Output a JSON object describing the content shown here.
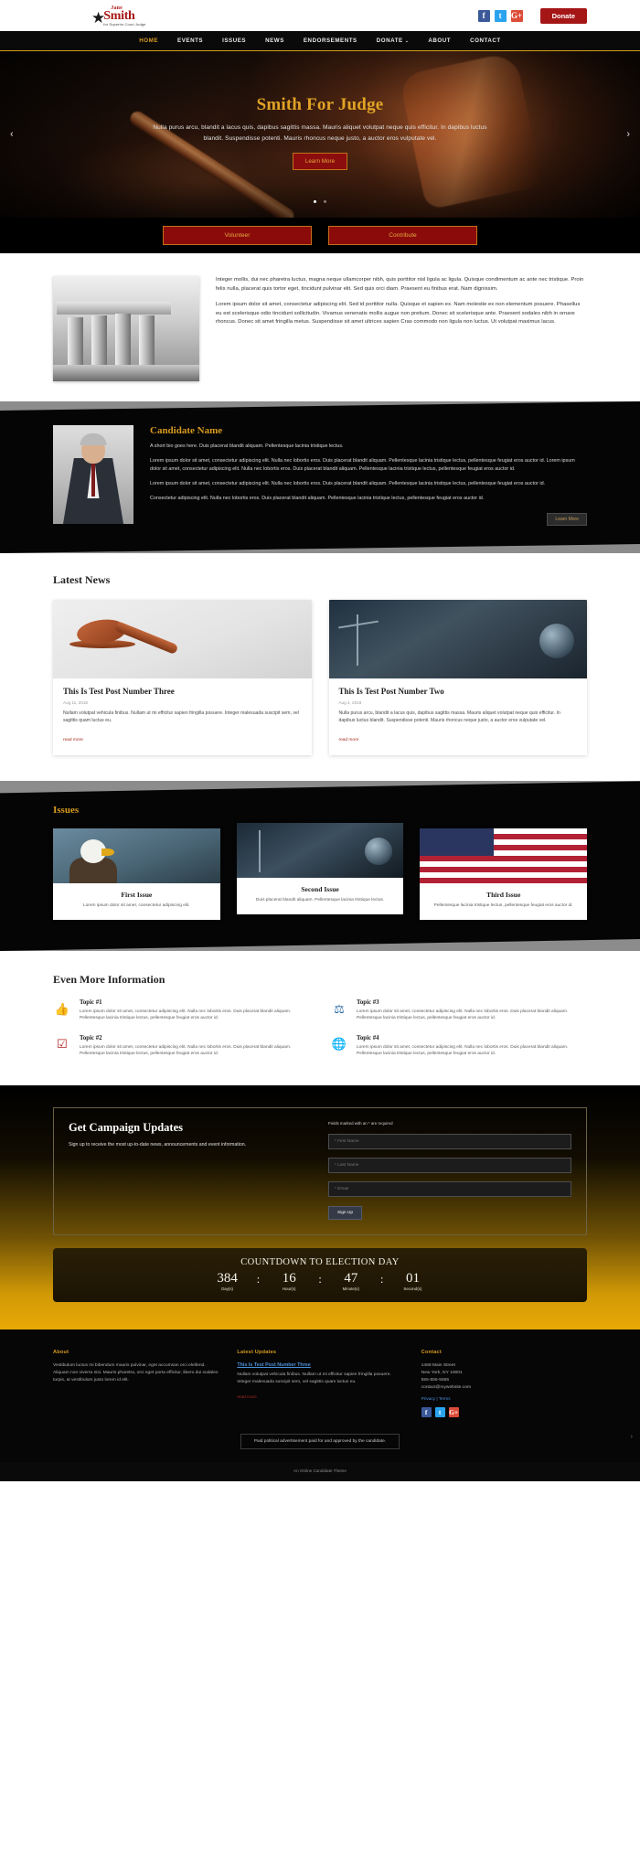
{
  "header": {
    "logo": {
      "first": "Jane",
      "last": "Smith",
      "tagline": "for Superior Court Judge",
      "star": "★"
    },
    "social": [
      {
        "name": "facebook-icon",
        "glyph": "f"
      },
      {
        "name": "twitter-icon",
        "glyph": "t"
      },
      {
        "name": "google-plus-icon",
        "glyph": "G+"
      }
    ],
    "donate_label": "Donate"
  },
  "nav": {
    "items": [
      {
        "label": "HOME",
        "active": true
      },
      {
        "label": "EVENTS",
        "active": false
      },
      {
        "label": "ISSUES",
        "active": false
      },
      {
        "label": "NEWS",
        "active": false
      },
      {
        "label": "ENDORSEMENTS",
        "active": false
      },
      {
        "label": "DONATE",
        "active": false,
        "caret": "⌄"
      },
      {
        "label": "ABOUT",
        "active": false
      },
      {
        "label": "CONTACT",
        "active": false
      }
    ]
  },
  "hero": {
    "title": "Smith For Judge",
    "subtitle": "Nulla purus arcu, blandit a lacus quis, dapibus sagittis massa. Mauris aliquet volutpat neque quis efficitur. In dapibus luctus blandit. Suspendisse potenti. Mauris rhoncus neque justo, a auctor eros vulputate vel.",
    "button": "Learn More",
    "prev": "‹",
    "next": "›"
  },
  "cta": {
    "volunteer": "Volunteer",
    "contribute": "Contribute"
  },
  "intro": {
    "p1": "Integer mollis, dui nec pharetra luctus, magna neque ullamcorper nibh, quis porttitor nisl ligula ac ligula. Quisque condimentum ac ante nec tristique. Proin felis nulla, placerat quis tortor eget, tincidunt pulvinar elit. Sed quis orci diam. Praesent eu finibus erat. Nam dignissim.",
    "p2": "Lorem ipsum dolor sit amet, consectetur adipiscing elit. Sed id porttitor nulla. Quisque et sapien ex. Nam molestie ex non elementum posuere. Phasellus eu est scelerisque odio tincidunt sollicitudin. Vivamus venenatis mollis augue non pretium. Donec sit scelerisque ante. Praesent sodales nibh in ornare rhoncus. Donec sit amet fringilla metus. Suspendisse sit amet ultrices sapien Cras commodo non ligula non luctus. Ut volutpat maximus lacus."
  },
  "candidate": {
    "title": "Candidate Name",
    "p1": "A short bio goes here. Duis placerat blandit aliquam. Pellentesque lacinia tristique lectus.",
    "p2": "Lorem ipsum dolor sit amet, consectetur adipiscing elit. Nulla nec lobortis eros. Duis placerat blandit aliquam. Pellentesque lacinia tristique lectus, pellentesque feugiat eros auctor id. Lorem ipsum dolor sit amet, consectetur adipiscing elit. Nulla nec lobortis eros. Duis placerat blandit aliquam. Pellentesque lacinia tristique lectus, pellentesque feugiat eros auctor id.",
    "p3": "Lorem ipsum dolor sit amet, consectetur adipiscing elit. Nulla nec lobortis eros. Duis placerat blandit aliquam. Pellentesque lacinia tristique lectus, pellentesque feugiat eros auctor id.",
    "p4": "Consectetur adipiscing elit. Nulla nec lobortis eros. Duis placerat blandit aliquam. Pellentesque lacinia tristique lectus, pellentesque feugiat eros auctor id.",
    "button": "Learn More"
  },
  "news": {
    "title": "Latest News",
    "read_more": "read more",
    "posts": [
      {
        "title": "This Is Test Post Number Three",
        "date": "Aug 11, 2018",
        "excerpt": "Nullam volutpat vehicula finibus. Nullam ut mi efficitur sapien fringilla posuere. Integer malesuada suscipit sem, vel sagittis quam luctus eu."
      },
      {
        "title": "This Is Test Post Number Two",
        "date": "Aug 4, 2018",
        "excerpt": "Nulla purus arcu, blandit a lacus quis, dapibus sagittis massa. Mauris aliquet volutpat neque quis efficitur. In dapibus luctus blandit. Suspendisse potenti. Mauris rhoncus neque justo, a auctor eros vulputate vel."
      }
    ]
  },
  "issues": {
    "title": "Issues",
    "cards": [
      {
        "name": "First Issue",
        "text": "Lorem ipsum dolor sit amet, consectetur adipiscing elit."
      },
      {
        "name": "Second Issue",
        "text": "Duis placerat blandit aliquam. Pellentesque lacinia tristique lectus."
      },
      {
        "name": "Third Issue",
        "text": "Pellentesque lacinia tristique lectus, pellentesque feugiat eros auctor id."
      }
    ]
  },
  "more_info": {
    "title": "Even More Information",
    "topics": [
      {
        "name": "Topic #1",
        "icon": "thumbs-up-icon",
        "glyph": "👍",
        "text": "Lorem ipsum dolor sit amet, consectetur adipiscing elit. Nulla nec lobortis eros. Duis placerat blandit aliquam. Pellentesque lacinia tristique lectus, pellentesque feugiat eros auctor id."
      },
      {
        "name": "Topic #3",
        "icon": "scales-icon",
        "glyph": "⚖",
        "text": "Lorem ipsum dolor sit amet, consectetur adipiscing elit. Nulla nec lobortis eros. Duis placerat blandit aliquam. Pellentesque lacinia tristique lectus, pellentesque feugiat eros auctor id."
      },
      {
        "name": "Topic #2",
        "icon": "checkbox-icon",
        "glyph": "☑",
        "text": "Lorem ipsum dolor sit amet, consectetur adipiscing elit. Nulla nec lobortis eros. Duis placerat blandit aliquam. Pellentesque lacinia tristique lectus, pellentesque feugiat eros auctor id."
      },
      {
        "name": "Topic #4",
        "icon": "globe-icon",
        "glyph": "🌐",
        "text": "Lorem ipsum dolor sit amet, consectetur adipiscing elit. Nulla nec lobortis eros. Duis placerat blandit aliquam. Pellentesque lacinia tristique lectus, pellentesque feugiat eros auctor id."
      }
    ]
  },
  "signup": {
    "title": "Get Campaign Updates",
    "description": "Sign up to receive the most up-to-date news, announcements and event information.",
    "required_note": "Fields marked with an * are required",
    "first_name_placeholder": "* First Name",
    "last_name_placeholder": "* Last Name",
    "email_placeholder": "* Email",
    "first_name_value": "",
    "last_name_value": "",
    "email_value": "",
    "button": "Sign Up"
  },
  "countdown": {
    "title": "COUNTDOWN TO ELECTION DAY",
    "separator": ":",
    "units": [
      {
        "value": "384",
        "label": "Day(s)"
      },
      {
        "value": "16",
        "label": "Hour(s)"
      },
      {
        "value": "47",
        "label": "Minute(s)"
      },
      {
        "value": "01",
        "label": "Second(s)"
      }
    ]
  },
  "footer": {
    "about": {
      "heading": "About",
      "text": "Vestibulum luctus mi bibendum mauris pulvinar, eget accumsan orci eleifend. Aliquam non viverra nisi. Mauris pharetra, orci eget porta efficitur, libero dui sodales turpis, at vestibulum justo lorem id elit."
    },
    "latest": {
      "heading": "Latest Updates",
      "link": "This Is Test Post Number Three",
      "text": "Nullam volutpat vehicula finibus. Nullam ut mi efficitur sapien fringilla posuere. Integer malesuada suscipit sem, vel sagittis quam luctus eu.",
      "read_more": "read more"
    },
    "contact": {
      "heading": "Contact",
      "address1": "1469 Main Street",
      "address2": "New York, NY 10001",
      "phone": "555-555-5555",
      "email": "contact@mywebsite.com",
      "privacy": "Privacy",
      "terms": "Terms",
      "separator": " | ",
      "social": [
        {
          "name": "facebook-icon",
          "glyph": "f"
        },
        {
          "name": "twitter-icon",
          "glyph": "t"
        },
        {
          "name": "google-plus-icon",
          "glyph": "G+"
        }
      ]
    },
    "disclaimer": "Paid political advertisement paid for and approved by the candidate.",
    "credit": "An Online Candidate Theme",
    "scroll_top": "›"
  }
}
